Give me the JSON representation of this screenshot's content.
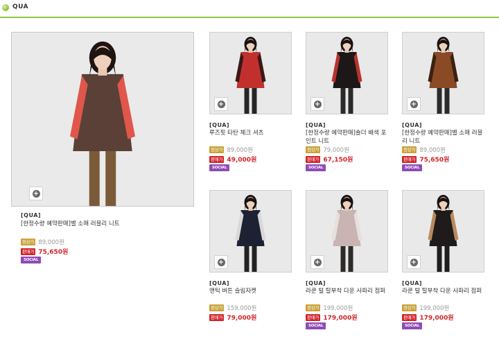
{
  "header": {
    "title": "QUA"
  },
  "labels": {
    "list_price": "정상가",
    "sale_price": "판매가",
    "social": "SOCIAL"
  },
  "featured": {
    "brand": "[QUA]",
    "name": "[한정수량 예약판매]벨 소매 러블리 니트",
    "list_price": "89,000원",
    "sale_price": "75,650원",
    "social": true,
    "colors": {
      "top": "#5a4036",
      "accent": "#e0564a",
      "bottom": "#7b5a3a",
      "hair": "#1f1410"
    }
  },
  "products": [
    {
      "brand": "[QUA]",
      "name": "루즈핏 타탄 체크 셔츠",
      "list_price": "89,000원",
      "sale_price": "49,000원",
      "social": true,
      "colors": {
        "top": "#c2302e",
        "accent": "#3a1818",
        "bottom": "#262626",
        "hair": "#1a1210"
      }
    },
    {
      "brand": "[QUA]",
      "name": "[한정수량 예약판매]숄더 배색 포인트 니트",
      "list_price": "79,000원",
      "sale_price": "67,150원",
      "social": true,
      "colors": {
        "top": "#1d1717",
        "accent": "#b7342d",
        "bottom": "#2a2a2a",
        "hair": "#1a1210"
      }
    },
    {
      "brand": "[QUA]",
      "name": "[한정수량 예약판매]벨 소매 러블리 니트",
      "list_price": "89,000원",
      "sale_price": "75,650원",
      "social": true,
      "colors": {
        "top": "#8a4a25",
        "accent": "#3b2110",
        "bottom": "#2b2b2b",
        "hair": "#1a1210"
      }
    },
    {
      "brand": "[QUA]",
      "name": "앤틱 버튼 슬림자켓",
      "list_price": "159,000원",
      "sale_price": "79,000원",
      "social": false,
      "colors": {
        "top": "#1c2233",
        "accent": "#d8d8d8",
        "bottom": "#222222",
        "hair": "#1a1210"
      }
    },
    {
      "brand": "[QUA]",
      "name": "라쿤 털 탈부착 다운 사파리 점퍼",
      "list_price": "199,000원",
      "sale_price": "179,000원",
      "social": true,
      "colors": {
        "top": "#c9b3b3",
        "accent": "#e6e0dc",
        "bottom": "#2e2a2a",
        "hair": "#1a1210"
      }
    },
    {
      "brand": "[QUA]",
      "name": "라쿤 털 탈부착 다운 사파리 점퍼",
      "list_price": "199,000원",
      "sale_price": "179,000원",
      "social": true,
      "colors": {
        "top": "#1e1b1a",
        "accent": "#b88a5e",
        "bottom": "#1e1e1e",
        "hair": "#1a1210"
      }
    }
  ]
}
